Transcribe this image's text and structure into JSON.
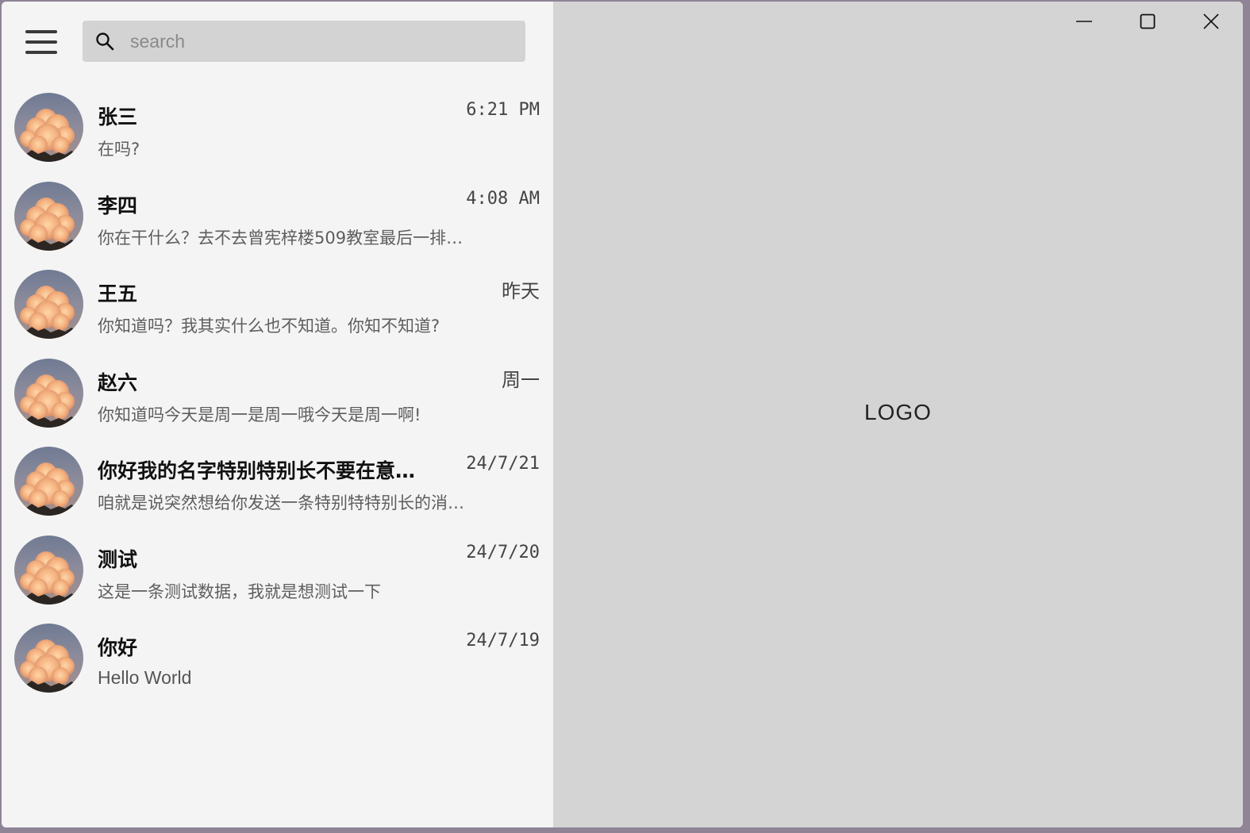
{
  "search": {
    "placeholder": "search"
  },
  "chats": [
    {
      "name": "张三",
      "time": "6:21 PM",
      "preview": "在吗?"
    },
    {
      "name": "李四",
      "time": "4:08 AM",
      "preview": "你在干什么？去不去曾宪梓楼509教室最后一排…"
    },
    {
      "name": "王五",
      "time": "昨天",
      "preview": "你知道吗？我其实什么也不知道。你知不知道?"
    },
    {
      "name": "赵六",
      "time": "周一",
      "preview": "你知道吗今天是周一是周一哦今天是周一啊!"
    },
    {
      "name": "你好我的名字特别特别长不要在意…",
      "time": "24/7/21",
      "preview": "咱就是说突然想给你发送一条特别特特别长的消…"
    },
    {
      "name": "测试",
      "time": "24/7/20",
      "preview": "这是一条测试数据，我就是想测试一下"
    },
    {
      "name": "你好",
      "time": "24/7/19",
      "preview": "Hello World"
    }
  ],
  "main": {
    "logo": "LOGO"
  },
  "icons": {
    "menu": "hamburger-menu-icon",
    "search": "search-icon",
    "minimize": "minimize-icon",
    "maximize": "maximize-icon",
    "close": "close-icon"
  },
  "colors": {
    "sidebar_bg": "#f4f4f4",
    "search_bg": "#d3d3d3",
    "main_bg": "#d4d4d4"
  }
}
